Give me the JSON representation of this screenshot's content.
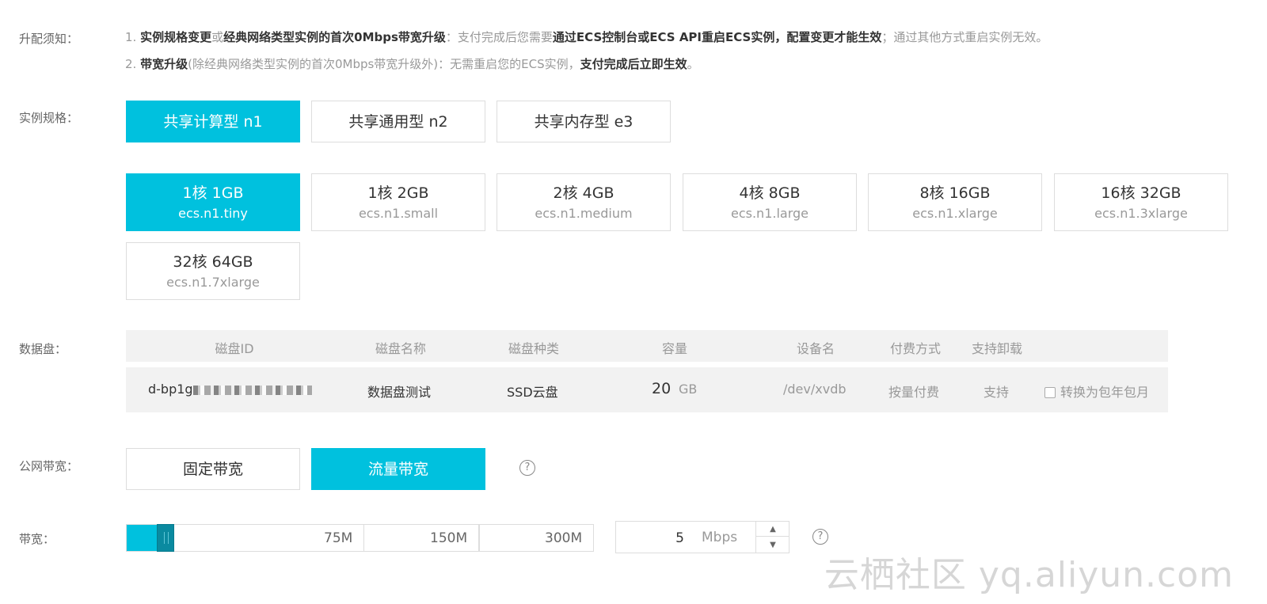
{
  "labels": {
    "notice": "升配须知：",
    "instance_type": "实例规格：",
    "data_disk": "数据盘：",
    "public_bandwidth": "公网带宽：",
    "bandwidth": "带宽："
  },
  "notice": {
    "line1": {
      "n": "1. ",
      "b1": "实例规格变更",
      "t1": "或",
      "b2": "经典网络类型实例的首次0Mbps带宽升级",
      "t2": "：支付完成后您需要",
      "b3": "通过ECS控制台或ECS API重启ECS实例，配置变更才能生效",
      "t3": "；通过其他方式重启实例无效。"
    },
    "line2": {
      "n": "2. ",
      "b1": "带宽升级",
      "t1": "(除经典网络类型实例的首次0Mbps带宽升级外)：无需重启您的ECS实例，",
      "b2": "支付完成后立即生效",
      "t2": "。"
    }
  },
  "families": [
    {
      "label": "共享计算型 n1",
      "selected": true
    },
    {
      "label": "共享通用型 n2",
      "selected": false
    },
    {
      "label": "共享内存型 e3",
      "selected": false
    }
  ],
  "specs": [
    {
      "label": "1核 1GB",
      "code": "ecs.n1.tiny",
      "selected": true
    },
    {
      "label": "1核 2GB",
      "code": "ecs.n1.small",
      "selected": false
    },
    {
      "label": "2核 4GB",
      "code": "ecs.n1.medium",
      "selected": false
    },
    {
      "label": "4核 8GB",
      "code": "ecs.n1.large",
      "selected": false
    },
    {
      "label": "8核 16GB",
      "code": "ecs.n1.xlarge",
      "selected": false
    },
    {
      "label": "16核 32GB",
      "code": "ecs.n1.3xlarge",
      "selected": false
    },
    {
      "label": "32核 64GB",
      "code": "ecs.n1.7xlarge",
      "selected": false
    }
  ],
  "disk_table": {
    "headers": [
      "磁盘ID",
      "磁盘名称",
      "磁盘种类",
      "容量",
      "设备名",
      "付费方式",
      "支持卸载"
    ],
    "row": {
      "id_prefix": "d-bp1g",
      "name": "数据盘测试",
      "type": "SSD云盘",
      "capacity": "20",
      "unit": "GB",
      "device": "/dev/xvdb",
      "billing": "按量付费",
      "detachable": "支持",
      "convert_label": "转换为包年包月"
    }
  },
  "bandwidth_types": [
    {
      "label": "固定带宽",
      "selected": false
    },
    {
      "label": "流量带宽",
      "selected": true
    }
  ],
  "bandwidth": {
    "ticks": [
      "75M",
      "150M",
      "300M"
    ],
    "value": "5",
    "unit": "Mbps",
    "fill_fraction": 0.017
  },
  "watermark": "云栖社区 yq.aliyun.com",
  "colors": {
    "accent": "#00c1de"
  }
}
